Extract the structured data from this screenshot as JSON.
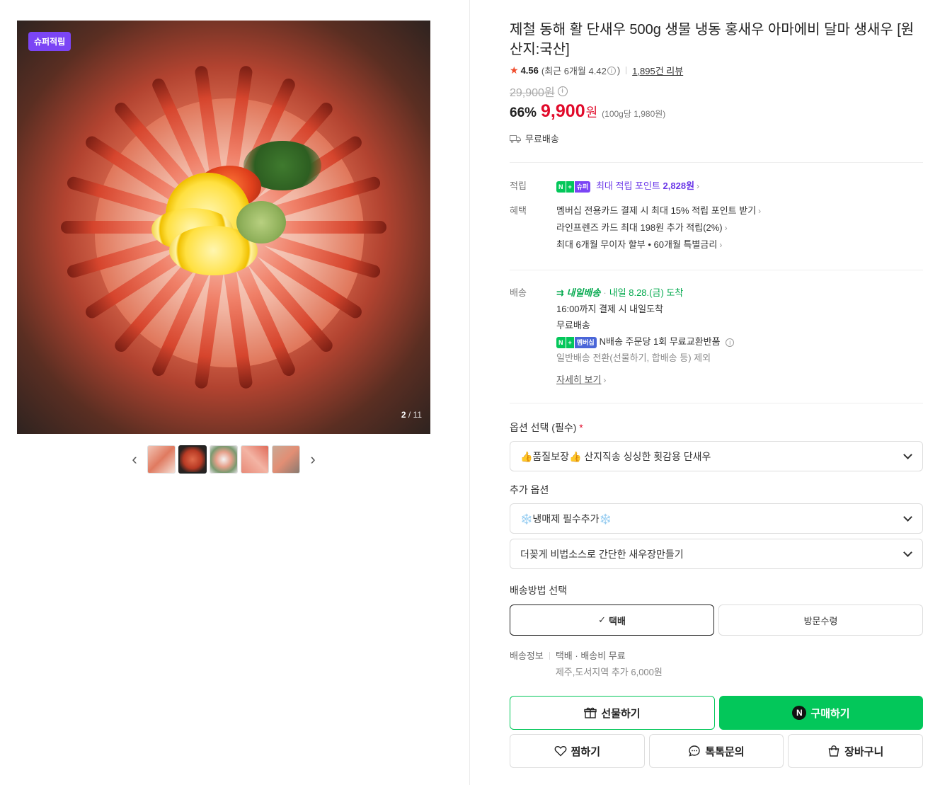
{
  "gallery": {
    "badge": "슈퍼적립",
    "counter_current": "2",
    "counter_total": "/ 11",
    "prev_icon": "chevron-left-icon",
    "next_icon": "chevron-right-icon"
  },
  "product": {
    "title": "제철 동해 활 단새우 500g 생물 냉동 홍새우 아마에비 달마 생새우 [원산지:국산]",
    "rating": "4.56",
    "rating_recent": "(최근 6개월 4.42",
    "rating_recent_close": ")",
    "review_count": "1,895건 리뷰",
    "original_price": "29,900원",
    "discount_rate": "66%",
    "price": "9,900",
    "price_unit": "원",
    "unit_price": "(100g당 1,980원)",
    "shipping_free": "무료배송"
  },
  "benefits": {
    "points_label": "적립",
    "points_badge_n": "N",
    "points_badge_plus": "+",
    "points_badge_super": "슈퍼",
    "points_text": "최대 적립 포인트",
    "points_value": "2,828원",
    "benefit_label": "혜택",
    "benefit_lines": [
      "멤버십 전용카드 결제 시 최대 15% 적립 포인트 받기",
      "라인프렌즈 카드 최대 198원 추가 적립(2%)",
      "최대 6개월 무이자 할부 • 60개월 특별금리"
    ]
  },
  "delivery": {
    "label": "배송",
    "tomorrow_badge": "내일배송",
    "arrival": "내일 8.28.(금) 도착",
    "cutoff": "16:00까지 결제 시 내일도착",
    "free": "무료배송",
    "membership_badge": "멤버십",
    "exchange": "N배송 주문당 1회 무료교환반품",
    "exclusion": "일반배송 전환(선물하기, 합배송 등) 제외",
    "details_link": "자세히 보기"
  },
  "options": {
    "required_label": "옵션 선택 (필수)",
    "required_mark": "*",
    "required_value": "👍품질보장👍 산지직송 싱싱한 횟감용 단새우",
    "additional_label": "추가 옵션",
    "additional_1": "❄️냉매제 필수추가❄️",
    "additional_2": "더꽂게 비법소스로 간단한 새우장만들기"
  },
  "shipping_method": {
    "label": "배송방법 선택",
    "courier": "택배",
    "pickup": "방문수령",
    "info_label": "배송정보",
    "info_text": "택배 · 배송비 무료",
    "info_extra": "제주,도서지역 추가 6,000원"
  },
  "actions": {
    "gift": "선물하기",
    "buy": "구매하기",
    "buy_n": "N",
    "wish": "찜하기",
    "talk": "톡톡문의",
    "cart": "장바구니"
  },
  "colors": {
    "accent_green": "#03c75a",
    "price_red": "#e10a2a",
    "super_purple": "#7b45f5"
  }
}
